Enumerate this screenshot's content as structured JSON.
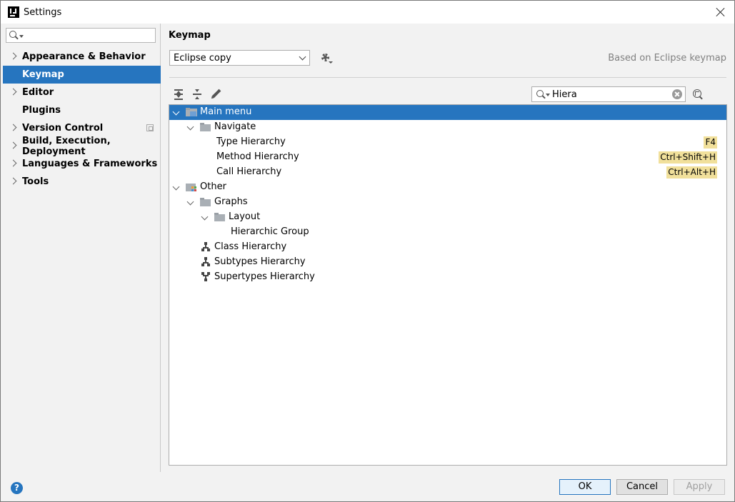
{
  "window": {
    "title": "Settings"
  },
  "sidebar": {
    "search_value": "",
    "items": [
      {
        "label": "Appearance & Behavior",
        "expandable": true,
        "selected": false
      },
      {
        "label": "Keymap",
        "expandable": false,
        "selected": true
      },
      {
        "label": "Editor",
        "expandable": true,
        "selected": false
      },
      {
        "label": "Plugins",
        "expandable": false,
        "selected": false
      },
      {
        "label": "Version Control",
        "expandable": true,
        "selected": false,
        "project_icon": true
      },
      {
        "label": "Build, Execution, Deployment",
        "expandable": true,
        "selected": false
      },
      {
        "label": "Languages & Frameworks",
        "expandable": true,
        "selected": false
      },
      {
        "label": "Tools",
        "expandable": true,
        "selected": false
      }
    ]
  },
  "main": {
    "title": "Keymap",
    "keymap_selected": "Eclipse copy",
    "based_on": "Based on Eclipse keymap",
    "filter_value": "Hiera",
    "toolbar": [
      "expand-all-icon",
      "collapse-all-icon",
      "edit-icon"
    ]
  },
  "tree": [
    {
      "label": "Main menu",
      "level": 0,
      "expanded": true,
      "icon": "main-menu-folder-icon",
      "selected": true
    },
    {
      "label": "Navigate",
      "level": 1,
      "expanded": true,
      "icon": "folder-icon"
    },
    {
      "label": "Type Hierarchy",
      "level": 2,
      "icon": "none",
      "shortcut": "F4"
    },
    {
      "label": "Method Hierarchy",
      "level": 2,
      "icon": "none",
      "shortcut": "Ctrl+Shift+H"
    },
    {
      "label": "Call Hierarchy",
      "level": 2,
      "icon": "none",
      "shortcut": "Ctrl+Alt+H"
    },
    {
      "label": "Other",
      "level": 0,
      "expanded": true,
      "icon": "other-folder-icon"
    },
    {
      "label": "Graphs",
      "level": 1,
      "expanded": true,
      "icon": "folder-icon"
    },
    {
      "label": "Layout",
      "level": 2,
      "expanded": true,
      "icon": "folder-icon"
    },
    {
      "label": "Hierarchic Group",
      "level": 3,
      "icon": "none"
    },
    {
      "label": "Class Hierarchy",
      "level": 1,
      "icon": "class-hierarchy-icon"
    },
    {
      "label": "Subtypes Hierarchy",
      "level": 1,
      "icon": "subtypes-hierarchy-icon"
    },
    {
      "label": "Supertypes Hierarchy",
      "level": 1,
      "icon": "supertypes-hierarchy-icon"
    }
  ],
  "buttons": {
    "ok": "OK",
    "cancel": "Cancel",
    "apply": "Apply",
    "help": "?"
  },
  "colors": {
    "selection": "#2675bf",
    "shortcut_highlight": "#f1e09b"
  }
}
